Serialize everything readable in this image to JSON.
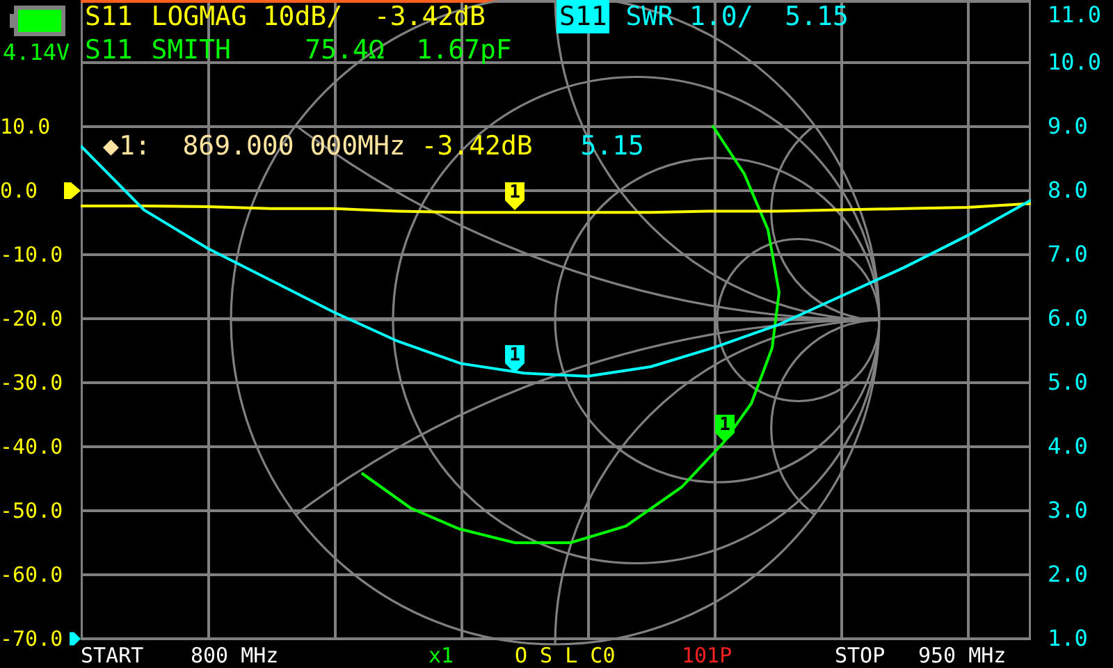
{
  "battery": {
    "voltage": "4.14V"
  },
  "traces": [
    {
      "channel": "S11",
      "format": "LOGMAG",
      "scale": "10dB/",
      "readings": [
        "-3.42dB"
      ],
      "color": "#ffff00",
      "selected": false
    },
    {
      "channel": "S11",
      "format": "SMITH",
      "readings": [
        "75.4Ω",
        "1.67pF"
      ],
      "color": "#00ff00",
      "selected": false
    },
    {
      "channel": "S11",
      "format": "SWR",
      "scale": "1.0/",
      "readings": [
        "5.15"
      ],
      "color": "#00ffff",
      "selected": true
    }
  ],
  "marker": {
    "symbol": "◆1:",
    "frequency": "869.000 000MHz",
    "readings": [
      {
        "text": "-3.42dB",
        "color": "#ffff00"
      },
      {
        "text": "5.15",
        "color": "#00ffff"
      }
    ]
  },
  "plot_markers": [
    {
      "label": "1",
      "color": "#ffff00"
    },
    {
      "label": "1",
      "color": "#00ffff"
    },
    {
      "label": "1",
      "color": "#00ff00"
    }
  ],
  "logmag_plot": {
    "chart_data": {
      "type": "line",
      "ylim": [
        -70,
        10
      ],
      "categories": [
        null,
        null,
        null,
        null,
        null,
        null,
        null,
        null,
        null,
        null,
        null,
        null,
        null,
        null,
        null,
        null
      ],
      "yticks": [
        {
          "value": 10,
          "label": "10.0"
        },
        {
          "value": 0,
          "label": "0.0"
        },
        {
          "value": -10,
          "label": "-10.0"
        },
        {
          "value": -20,
          "label": "-20.0"
        },
        {
          "value": -30,
          "label": "-30.0"
        },
        {
          "value": -40,
          "label": "-40.0"
        },
        {
          "value": -50,
          "label": "-50.0"
        },
        {
          "value": -60,
          "label": "-60.0"
        },
        {
          "value": -70,
          "label": "-70.0"
        }
      ],
      "series": [
        {
          "color": "#ffff00",
          "values": [
            -2.4,
            -2.4,
            -2.5,
            -2.8,
            -2.8,
            -3.2,
            -3.4,
            -3.4,
            -3.4,
            -3.4,
            -3.2,
            -3.2,
            -3.0,
            -2.8,
            -2.6,
            -2.0
          ]
        }
      ]
    }
  },
  "swr_plot": {
    "top_label": "11.0",
    "chart_data": {
      "type": "line",
      "ylim": [
        1,
        10
      ],
      "categories": [
        null,
        null,
        null,
        null,
        null,
        null,
        null,
        null,
        null,
        null,
        null,
        null,
        null,
        null,
        null,
        null
      ],
      "yticks": [
        {
          "value": 10,
          "label": "10.0"
        },
        {
          "value": 9,
          "label": "9.0"
        },
        {
          "value": 8,
          "label": "8.0"
        },
        {
          "value": 7,
          "label": "7.0"
        },
        {
          "value": 6,
          "label": "6.0"
        },
        {
          "value": 5,
          "label": "5.0"
        },
        {
          "value": 4,
          "label": "4.0"
        },
        {
          "value": 3,
          "label": "3.0"
        },
        {
          "value": 2,
          "label": "2.0"
        },
        {
          "value": 1,
          "label": "1.0"
        }
      ],
      "series": [
        {
          "color": "#00ffff",
          "values": [
            8.7,
            7.7,
            7.1,
            6.6,
            6.1,
            5.65,
            5.3,
            5.15,
            5.1,
            5.25,
            5.55,
            5.9,
            6.35,
            6.8,
            7.3,
            7.85
          ]
        }
      ]
    }
  },
  "status_bar": {
    "start_label": "START",
    "start_value": "800 MHz",
    "zoom": "x1",
    "calibration": "O S L C0",
    "points": "101P",
    "stop_label": "STOP",
    "stop_value": "950 MHz"
  }
}
